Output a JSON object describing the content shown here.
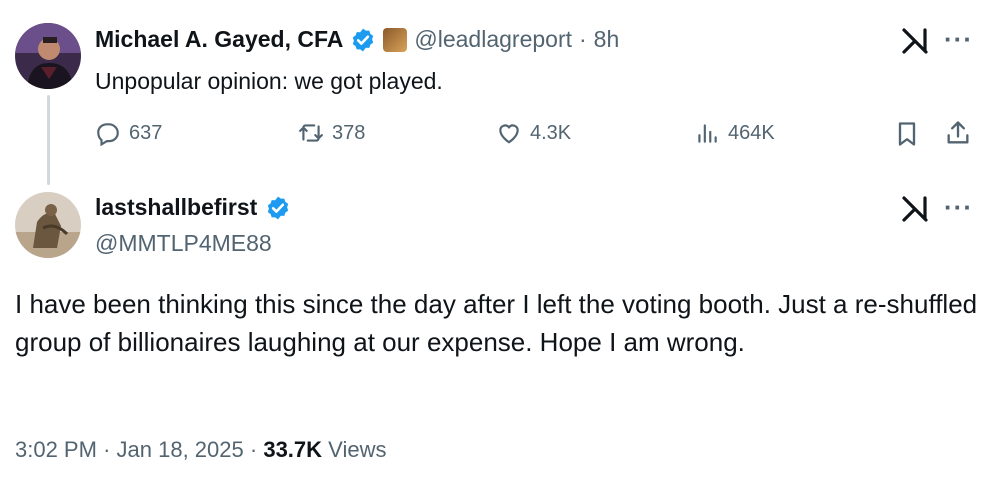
{
  "tweet1": {
    "name": "Michael A. Gayed, CFA",
    "handle": "@leadlagreport",
    "separator": "·",
    "time": "8h",
    "text": "Unpopular opinion: we got played.",
    "replies": "637",
    "retweets": "378",
    "likes": "4.3K",
    "views": "464K",
    "more": "···"
  },
  "tweet2": {
    "name": "lastshallbefirst",
    "handle": "@MMTLP4ME88",
    "text": "I have been thinking this since the day after I left the voting booth.  Just a re-shuffled group of billionaires laughing at our expense.  Hope I am wrong.",
    "time": "3:02 PM",
    "sep1": "·",
    "date": "Jan 18, 2025",
    "sep2": "·",
    "views_count": "33.7K",
    "views_label": "Views",
    "more": "···"
  },
  "colors": {
    "verified": "#1d9bf0",
    "muted": "#536471",
    "text": "#0f1419"
  },
  "icons": [
    "verified-badge-icon",
    "reply-icon",
    "retweet-icon",
    "like-icon",
    "views-icon",
    "bookmark-icon",
    "share-icon",
    "grok-icon",
    "more-icon"
  ]
}
